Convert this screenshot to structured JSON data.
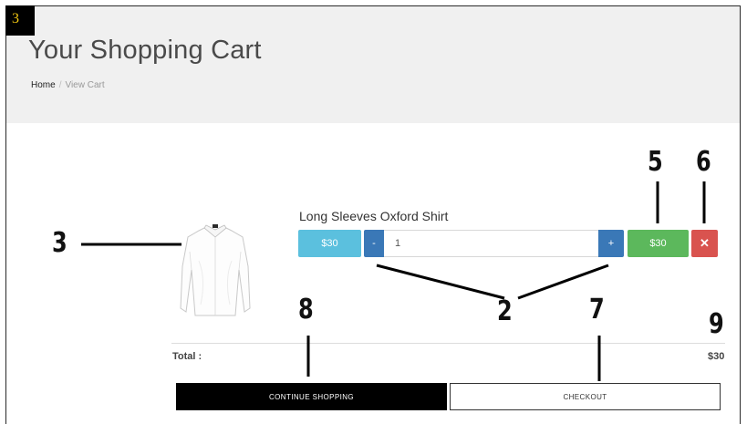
{
  "badge": "3",
  "page_title": "Your Shopping Cart",
  "breadcrumb": {
    "home": "Home",
    "separator": "/",
    "current": "View Cart"
  },
  "cart": {
    "item": {
      "name": "Long Sleeves Oxford Shirt",
      "price_label": "$30",
      "minus_label": "-",
      "quantity": "1",
      "plus_label": "+",
      "subtotal_label": "$30",
      "remove_label": "✕"
    },
    "total_label": "Total :",
    "total_value": "$30",
    "continue_label": "CONTINUE SHOPPING",
    "checkout_label": "CHECKOUT"
  },
  "annotations": {
    "image": "3",
    "quantity": "2",
    "subtotal": "5",
    "remove": "6",
    "checkout": "7",
    "continue": "8",
    "total": "9"
  },
  "colors": {
    "info": "#5bc0de",
    "primary": "#3a78b7",
    "success": "#5cb85c",
    "danger": "#d9534f",
    "badge_bg": "#000000",
    "badge_text": "#f2c811"
  }
}
